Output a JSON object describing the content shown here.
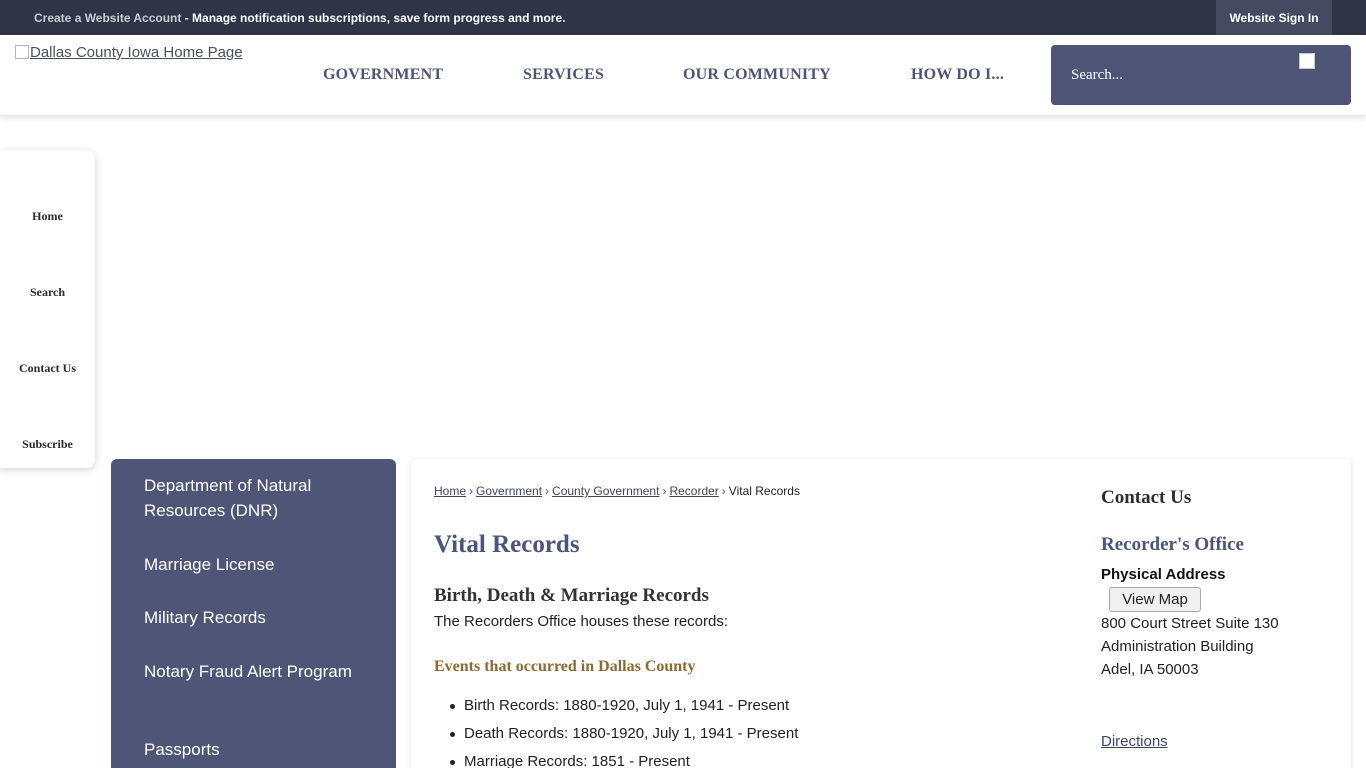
{
  "topbar": {
    "account_link": "Create a Website Account",
    "account_text": " - Manage notification subscriptions, save form progress and more.",
    "signin": "Website Sign In"
  },
  "header": {
    "logo_alt": "Dallas County Iowa Home Page",
    "nav": [
      "GOVERNMENT",
      "SERVICES",
      "OUR COMMUNITY",
      "HOW DO I..."
    ],
    "search_placeholder": "Search..."
  },
  "floatbar": [
    "Home",
    "Search",
    "Contact Us",
    "Subscribe"
  ],
  "sidenav": [
    "Department of Natural Resources (DNR)",
    "Marriage License",
    "Military Records",
    "Notary Fraud Alert Program",
    "Passports"
  ],
  "breadcrumb": {
    "links": [
      "Home",
      "Government",
      "County Government",
      "Recorder"
    ],
    "current": "Vital Records"
  },
  "main": {
    "title": "Vital Records",
    "subheading": "Birth, Death & Marriage Records",
    "intro": "The Recorders Office houses these records:",
    "events_heading": "Events that occurred in Dallas County",
    "records": [
      "Birth Records: 1880-1920, July 1, 1941 - Present",
      "Death Records: 1880-1920, July 1, 1941 - Present",
      "Marriage Records: 1851 - Present"
    ]
  },
  "contact": {
    "title": "Contact Us",
    "office": "Recorder's Office",
    "address_label": "Physical Address",
    "map_button": "View Map",
    "address_lines": [
      "800 Court Street Suite 130",
      "Administration Building",
      "Adel, IA 50003"
    ],
    "directions": "Directions"
  },
  "colors": {
    "topbar": "#2f3447",
    "accent": "#4e5577",
    "events_heading": "#8d6a32"
  }
}
